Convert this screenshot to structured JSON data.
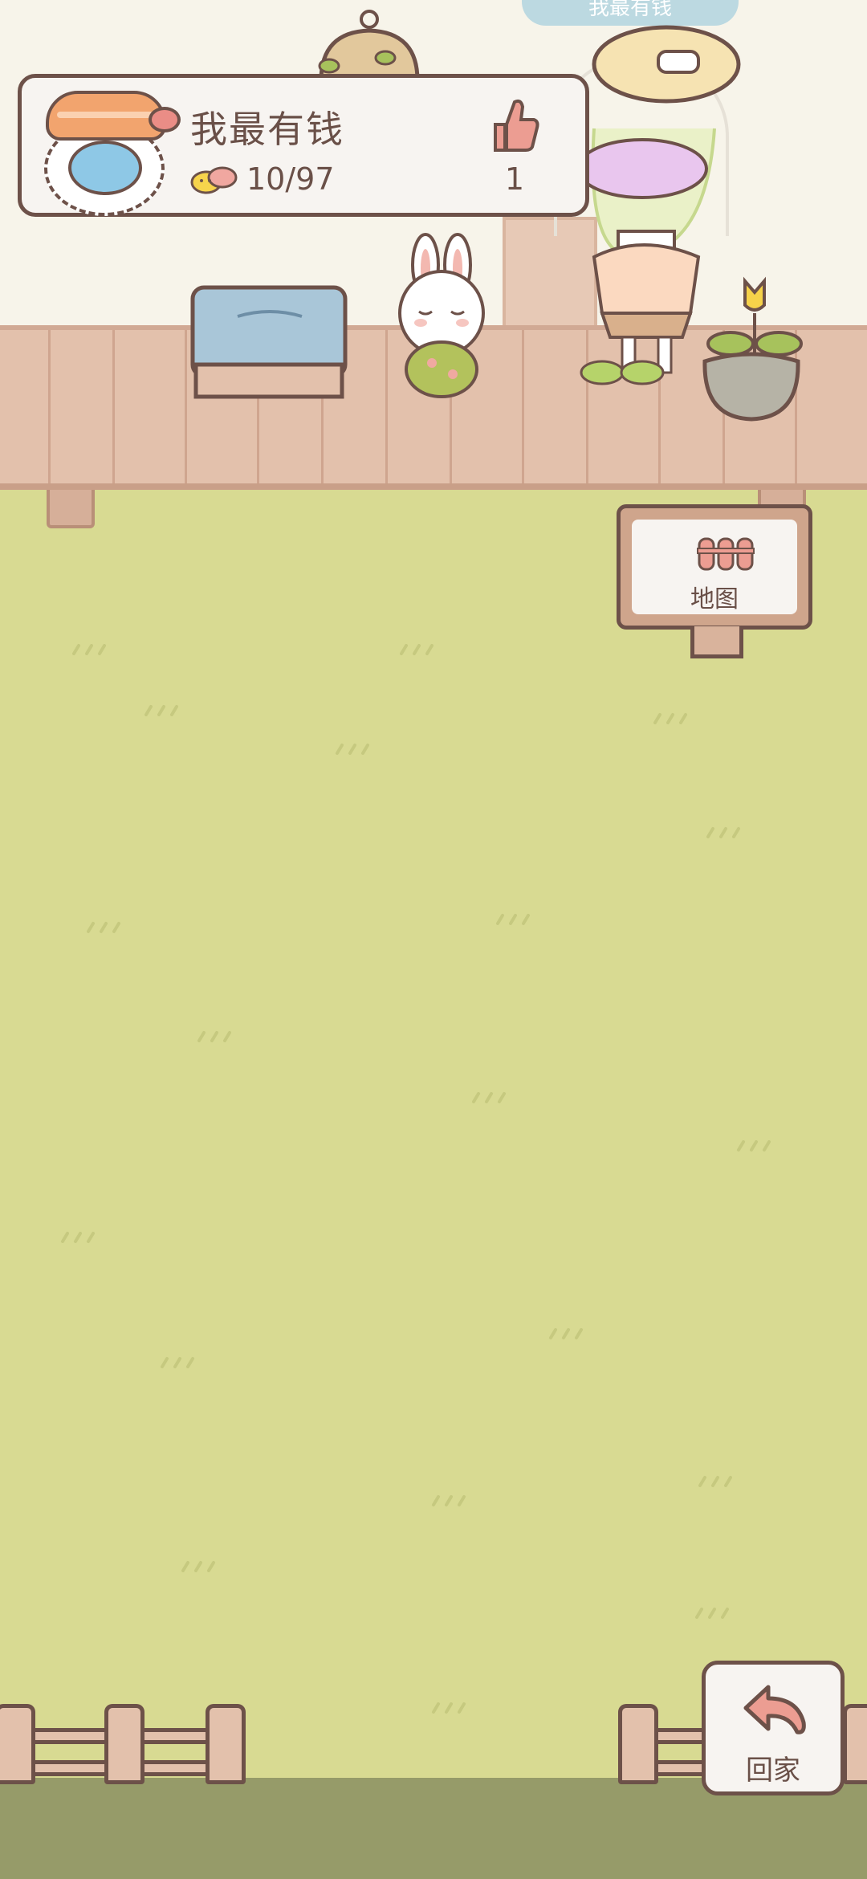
{
  "scene": {
    "top_name_tag": "我最有钱"
  },
  "profile": {
    "name": "我最有钱",
    "coins": "10/97",
    "likes": "1"
  },
  "map_sign": {
    "label": "地图"
  },
  "home_button": {
    "label": "回家"
  },
  "colors": {
    "grass": "#d8da92",
    "outline": "#6d5149",
    "accent_pink": "#ec9d92",
    "deck": "#e3c1ac"
  },
  "icons": [
    "avatar-icon",
    "coin-icon",
    "thumbs-up-icon",
    "fence-map-icon",
    "back-arrow-icon"
  ]
}
